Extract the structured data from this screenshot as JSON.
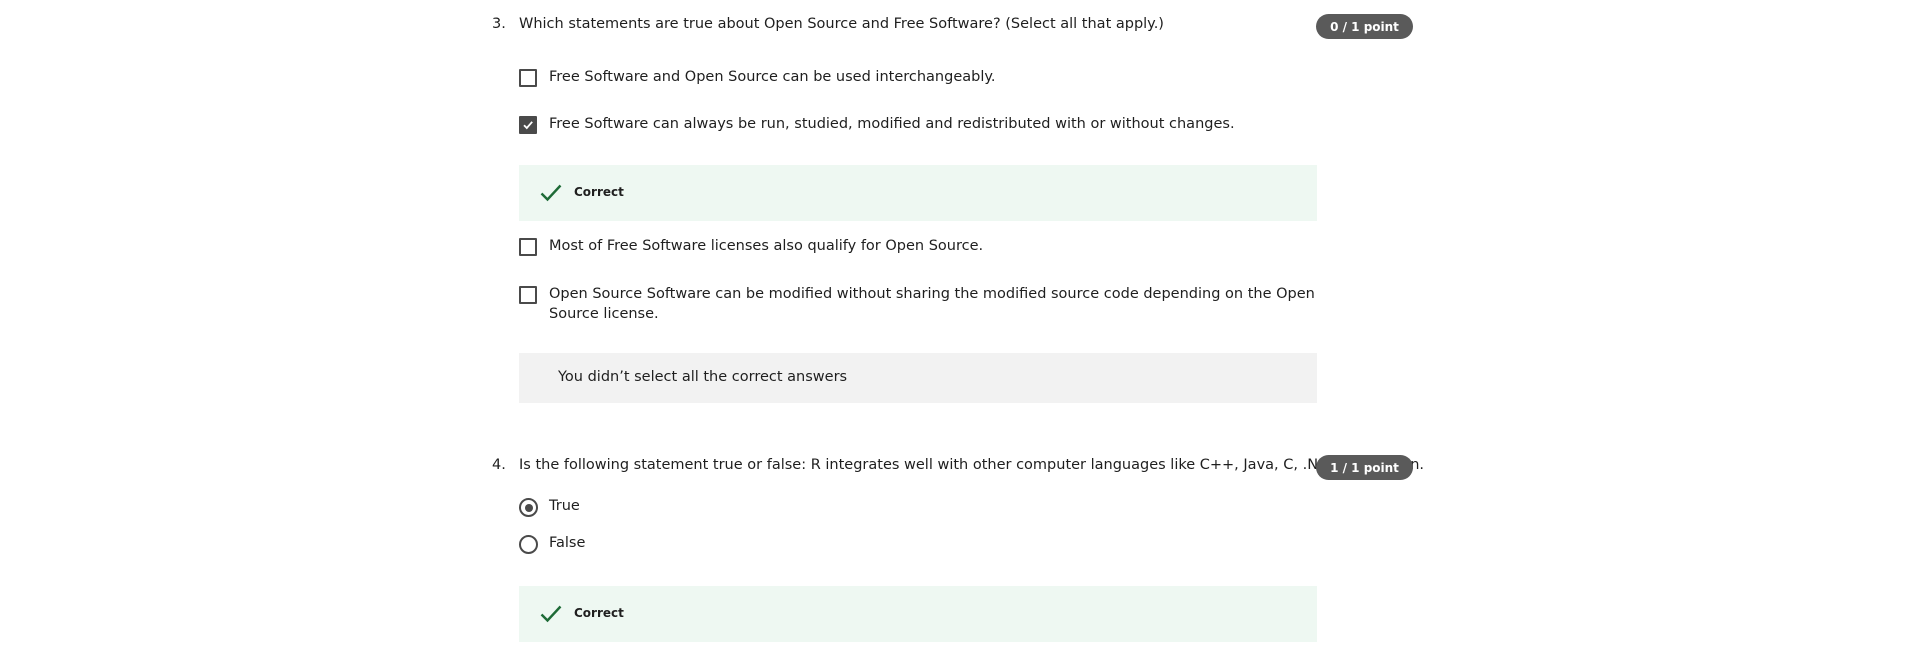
{
  "questions": [
    {
      "number": "3.",
      "text": "Which statements are true about Open Source and Free Software? (Select all that apply.)",
      "points": "0 / 1 point",
      "options": [
        {
          "label": "Free Software and Open Source can be used interchangeably.",
          "checked": false
        },
        {
          "label": "Free Software can always be run, studied, modified and redistributed with or without changes.",
          "checked": true
        },
        {
          "label": "Most of Free Software licenses also qualify for Open Source.",
          "checked": false
        },
        {
          "label": "Open Source Software can be modified without sharing the modified source code depending on the Open Source license.",
          "checked": false
        }
      ],
      "option_feedback": "Correct",
      "question_feedback": "You didn’t select all the correct answers"
    },
    {
      "number": "4.",
      "text": "Is the following statement true or false: R integrates well with other computer languages like C++, Java, C, .Net and Python.",
      "points": "1 / 1 point",
      "options": [
        {
          "label": "True",
          "selected": true
        },
        {
          "label": "False",
          "selected": false
        }
      ],
      "feedback": "Correct"
    }
  ],
  "colors": {
    "correct_bg": "#eef8f2",
    "correct_check": "#1e6b37",
    "neutral_feedback_bg": "#f2f2f2",
    "badge_bg": "#5a5a5a",
    "control_border": "#4a4a4a"
  },
  "icons": {
    "checkmark": "check-icon",
    "checkbox_checked": "checkbox-check-icon"
  }
}
